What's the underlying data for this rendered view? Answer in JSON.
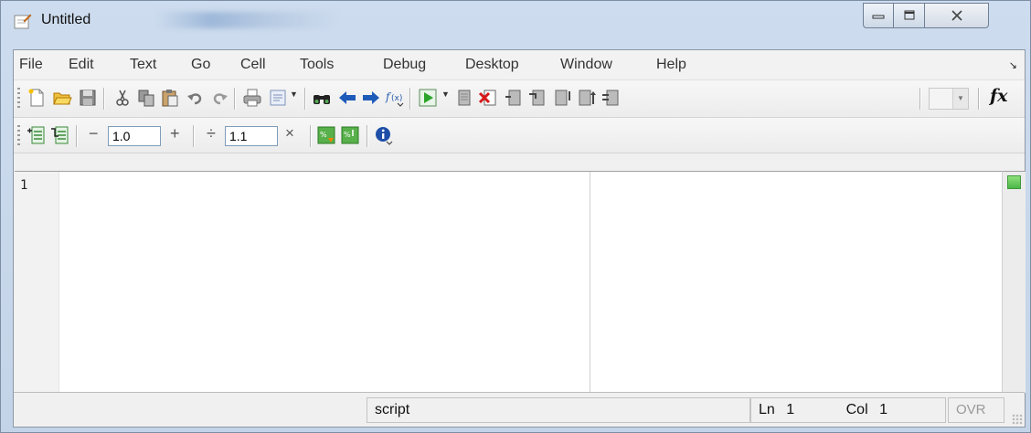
{
  "window": {
    "title": "Untitled"
  },
  "menu": [
    "File",
    "Edit",
    "Text",
    "Go",
    "Cell",
    "Tools",
    "Debug",
    "Desktop",
    "Window",
    "Help"
  ],
  "toolbar1": {
    "icons": [
      "new-file-icon",
      "open-file-icon",
      "save-icon",
      "cut-icon",
      "copy-icon",
      "paste-icon",
      "undo-icon",
      "redo-icon",
      "print-icon",
      "comment-icon",
      "find-icon",
      "back-icon",
      "forward-icon",
      "function-browser-icon",
      "run-icon",
      "breakpoint-set-icon",
      "breakpoint-clear-icon",
      "step-icon",
      "step-in-icon",
      "step-out-icon",
      "continue-icon",
      "exit-debug-icon"
    ],
    "fx_label": "fx"
  },
  "toolbar2": {
    "decrement_label": "−",
    "decrement_value": "1.0",
    "increment_label": "+",
    "divide_label": "÷",
    "divide_value": "1.1",
    "multiply_label": "×"
  },
  "editor": {
    "line_numbers": [
      "1"
    ]
  },
  "statusbar": {
    "mode": "script",
    "ln_label": "Ln",
    "ln_value": "1",
    "col_label": "Col",
    "col_value": "1",
    "ovr": "OVR"
  },
  "colors": {
    "window_frame": "#c4d4e8",
    "indicator": "#4cb648",
    "run_green": "#2aa52a"
  }
}
